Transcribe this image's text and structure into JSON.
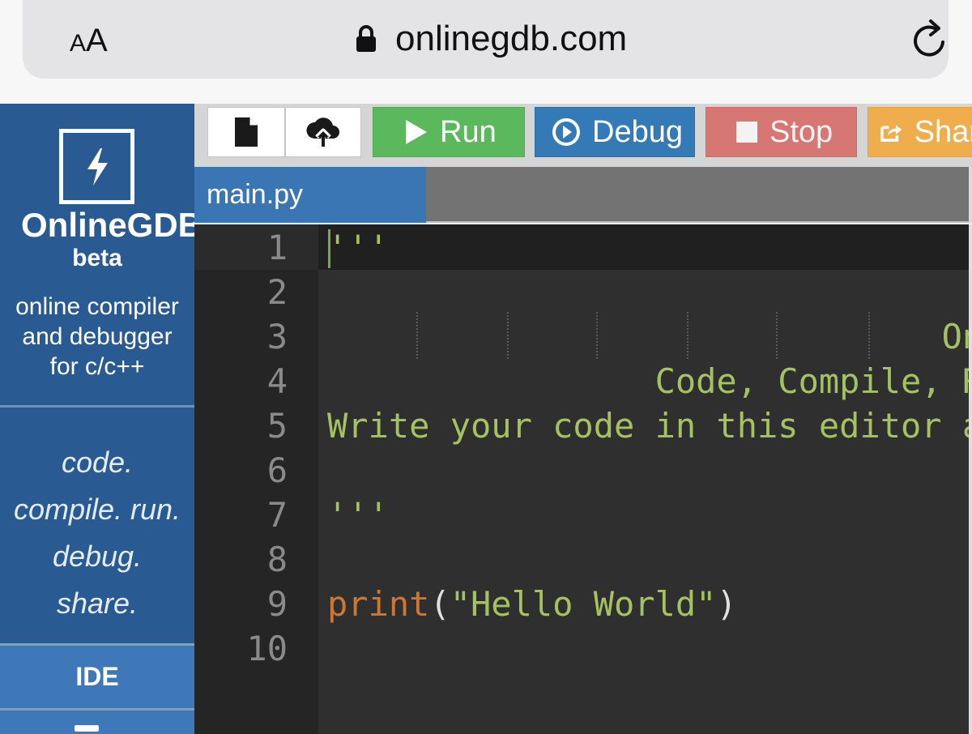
{
  "browser": {
    "text_size_small": "A",
    "text_size_large": "A",
    "url": "onlinegdb.com"
  },
  "sidebar": {
    "brand": "OnlineGDB",
    "beta": "beta",
    "tagline": [
      "online compiler",
      "and debugger",
      "for c/c++"
    ],
    "motto": [
      "code.",
      "compile. run.",
      "debug.",
      "share."
    ],
    "nav": [
      {
        "label": "IDE"
      }
    ]
  },
  "toolbar": {
    "run_label": "Run",
    "debug_label": "Debug",
    "stop_label": "Stop",
    "share_label": "Share"
  },
  "tabs": [
    {
      "label": "main.py"
    }
  ],
  "editor": {
    "lines": [
      {
        "num": "1",
        "text": "'''"
      },
      {
        "num": "2",
        "text": ""
      },
      {
        "num": "3",
        "text": "                              Online Python Compiler."
      },
      {
        "num": "4",
        "text": "                Code, Compile, Run and Debug python program online."
      },
      {
        "num": "5",
        "text": "Write your code in this editor and press \"Run\" button to execute it."
      },
      {
        "num": "6",
        "text": ""
      },
      {
        "num": "7",
        "text": "'''"
      },
      {
        "num": "8",
        "text": ""
      },
      {
        "num": "9",
        "fn": "print",
        "open": "(",
        "str": "\"Hello World\"",
        "close": ")"
      },
      {
        "num": "10",
        "text": ""
      }
    ]
  }
}
